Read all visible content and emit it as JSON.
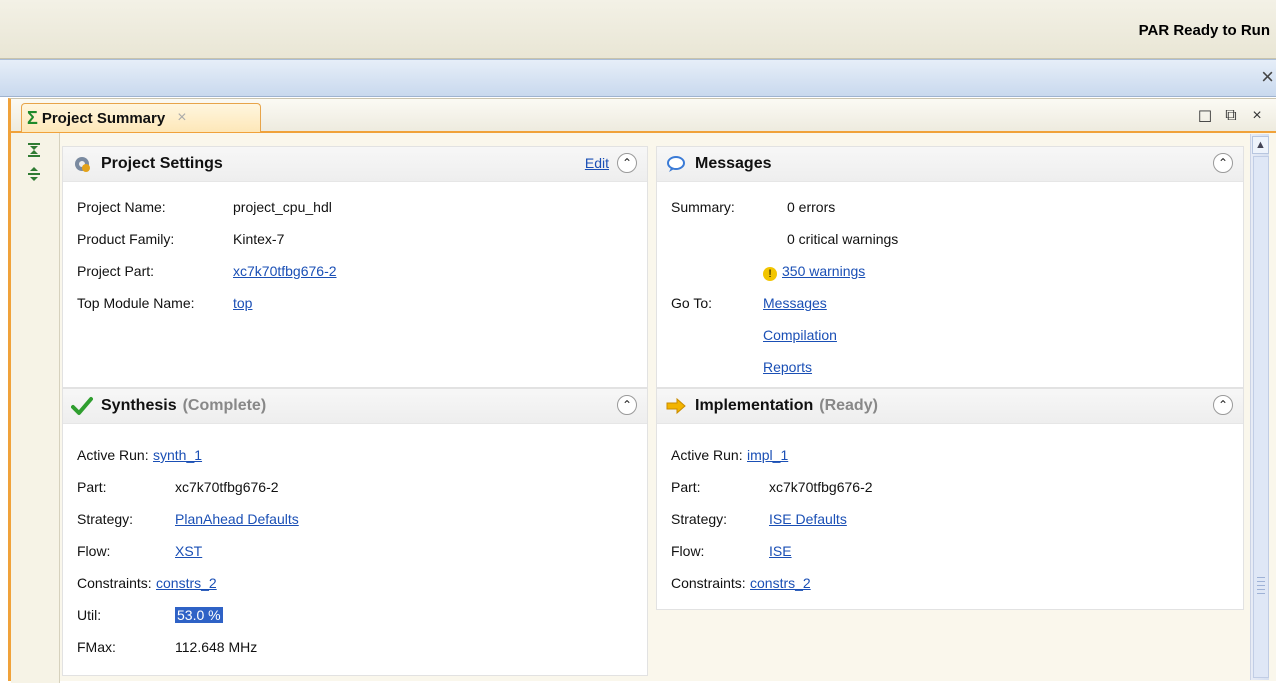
{
  "status": {
    "text": "PAR Ready to Run"
  },
  "tab": {
    "label": "Project Summary",
    "close": "×"
  },
  "window_controls": {
    "maximize": "☐",
    "restore": "⧉",
    "close": "×"
  },
  "project_settings": {
    "title": "Project Settings",
    "edit_label": "Edit",
    "rows": [
      {
        "key": "Project Name:",
        "value": "project_cpu_hdl",
        "link": false
      },
      {
        "key": "Product Family:",
        "value": "Kintex-7",
        "link": false
      },
      {
        "key": "Project Part:",
        "value": "xc7k70tfbg676-2",
        "link": true
      },
      {
        "key": "Top Module Name:",
        "value": "top",
        "link": true
      }
    ]
  },
  "messages": {
    "title": "Messages",
    "summary_label": "Summary:",
    "errors": "0 errors",
    "critical": "0 critical warnings",
    "warnings": "350 warnings",
    "goto_label": "Go To:",
    "links": [
      "Messages",
      "Compilation",
      "Reports"
    ]
  },
  "synthesis": {
    "title": "Synthesis",
    "state": "(Complete)",
    "rows": [
      {
        "key": "Active Run:",
        "value": "synth_1",
        "link": true
      },
      {
        "key": "Part:",
        "value": "xc7k70tfbg676-2",
        "link": false
      },
      {
        "key": "Strategy:",
        "value": "PlanAhead Defaults",
        "link": true
      },
      {
        "key": "Flow:",
        "value": "XST",
        "link": true
      },
      {
        "key": "Constraints:",
        "value": "constrs_2",
        "link": true
      },
      {
        "key": "Util:",
        "value": "53.0 %",
        "link": false,
        "selected": true
      },
      {
        "key": "FMax:",
        "value": "112.648 MHz",
        "link": false
      }
    ]
  },
  "implementation": {
    "title": "Implementation",
    "state": "(Ready)",
    "rows": [
      {
        "key": "Active Run:",
        "value": "impl_1",
        "link": true
      },
      {
        "key": "Part:",
        "value": "xc7k70tfbg676-2",
        "link": false
      },
      {
        "key": "Strategy:",
        "value": "ISE Defaults",
        "link": true
      },
      {
        "key": "Flow:",
        "value": "ISE",
        "link": true
      },
      {
        "key": "Constraints:",
        "value": "constrs_2",
        "link": true
      }
    ]
  },
  "colors": {
    "accent": "#f0a23a",
    "link": "#1a4fb5",
    "selection": "#2f62c6",
    "check": "#2f9e2f",
    "arrow": "#f2b400"
  }
}
